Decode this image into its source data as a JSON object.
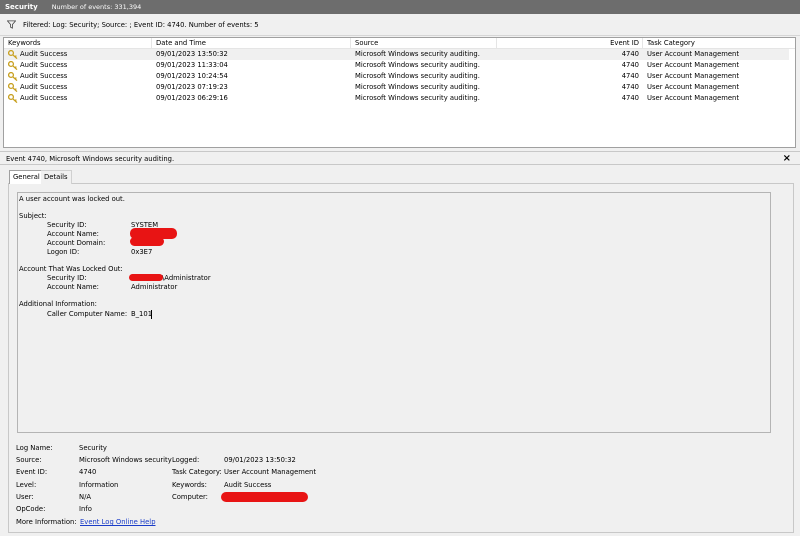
{
  "title_bar": {
    "log_name": "Security",
    "event_count": "Number of events: 331,394"
  },
  "filter": {
    "text": "Filtered: Log: Security; Source: ; Event ID: 4740. Number of events: 5"
  },
  "columns": [
    "Keywords",
    "Date and Time",
    "Source",
    "Event ID",
    "Task Category"
  ],
  "events": [
    {
      "keywords": "Audit Success",
      "datetime": "09/01/2023 13:50:32",
      "source": "Microsoft Windows security auditing.",
      "event_id": "4740",
      "task_category": "User Account Management"
    },
    {
      "keywords": "Audit Success",
      "datetime": "09/01/2023 11:33:04",
      "source": "Microsoft Windows security auditing.",
      "event_id": "4740",
      "task_category": "User Account Management"
    },
    {
      "keywords": "Audit Success",
      "datetime": "09/01/2023 10:24:54",
      "source": "Microsoft Windows security auditing.",
      "event_id": "4740",
      "task_category": "User Account Management"
    },
    {
      "keywords": "Audit Success",
      "datetime": "09/01/2023 07:19:23",
      "source": "Microsoft Windows security auditing.",
      "event_id": "4740",
      "task_category": "User Account Management"
    },
    {
      "keywords": "Audit Success",
      "datetime": "09/01/2023 06:29:16",
      "source": "Microsoft Windows security auditing.",
      "event_id": "4740",
      "task_category": "User Account Management"
    }
  ],
  "detail": {
    "header": "Event 4740, Microsoft Windows security auditing.",
    "close_glyph": "×",
    "tabs": [
      "General",
      "Details"
    ],
    "message": {
      "line1": "A user account was locked out.",
      "subject_title": "Subject:",
      "subject": [
        {
          "label": "Security ID:",
          "value": "SYSTEM"
        },
        {
          "label": "Account Name:",
          "value": ""
        },
        {
          "label": "Account Domain:",
          "value": ""
        },
        {
          "label": "Logon ID:",
          "value": "0x3E7"
        }
      ],
      "locked_title": "Account That Was Locked Out:",
      "locked": [
        {
          "label": "Security ID:",
          "value": "\\Administrator"
        },
        {
          "label": "Account Name:",
          "value": "Administrator"
        }
      ],
      "additional_title": "Additional Information:",
      "additional": [
        {
          "label": "Caller Computer Name:",
          "value": "B_101"
        }
      ]
    },
    "properties": {
      "log_name_label": "Log Name:",
      "log_name": "Security",
      "source_label": "Source:",
      "source": "Microsoft Windows security",
      "logged_label": "Logged:",
      "logged": "09/01/2023 13:50:32",
      "event_id_label": "Event ID:",
      "event_id": "4740",
      "task_category_label": "Task Category:",
      "task_category": "User Account Management",
      "level_label": "Level:",
      "level": "Information",
      "keywords_label": "Keywords:",
      "keywords": "Audit Success",
      "user_label": "User:",
      "user": "N/A",
      "computer_label": "Computer:",
      "computer": "",
      "opcode_label": "OpCode:",
      "opcode": "Info",
      "more_info_label": "More Information:",
      "more_info_link": "Event Log Online Help"
    }
  },
  "colors": {
    "title_bar": "#6d6d6d",
    "redaction": "#e81414",
    "link": "#1a3cc8",
    "key_icon": "#c8a020"
  }
}
